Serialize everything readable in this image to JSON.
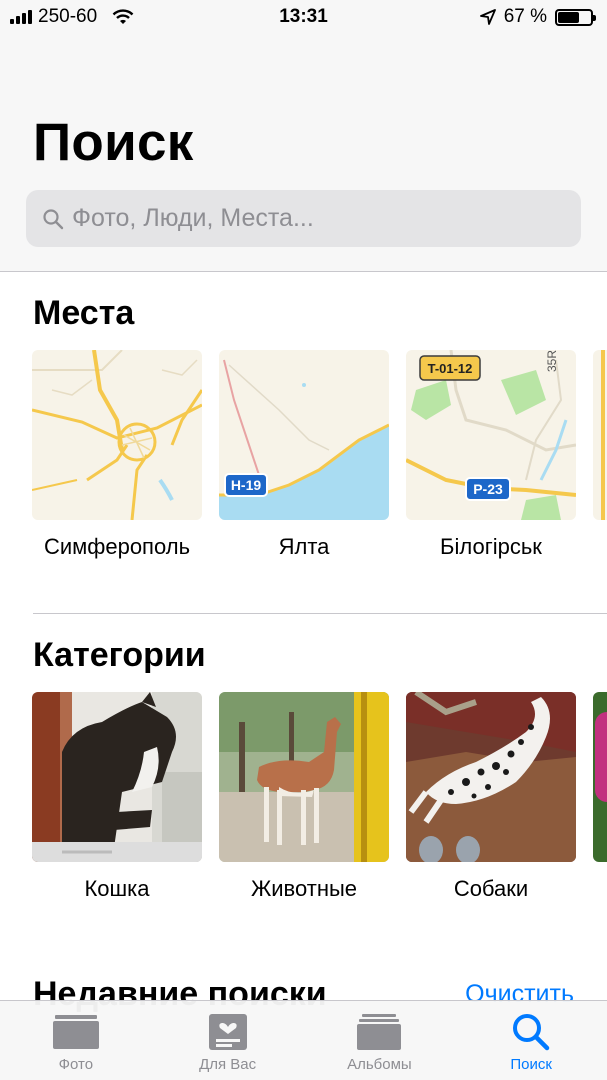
{
  "status_bar": {
    "carrier": "250-60",
    "time": "13:31",
    "battery_percent": "67 %",
    "battery_level": 0.67
  },
  "header": {
    "title": "Поиск"
  },
  "search": {
    "placeholder": "Фото, Люди, Места..."
  },
  "places": {
    "title": "Места",
    "items": [
      {
        "label": "Симферополь"
      },
      {
        "label": "Ялта",
        "road_badge": "H-19"
      },
      {
        "label": "Білогірськ",
        "road_badges": [
          "T-01-12",
          "P-23"
        ],
        "map_text": "35R"
      }
    ]
  },
  "categories": {
    "title": "Категории",
    "items": [
      {
        "label": "Кошка"
      },
      {
        "label": "Животные"
      },
      {
        "label": "Собаки"
      }
    ]
  },
  "recent": {
    "title": "Недавние поиски",
    "clear_label": "Очистить"
  },
  "tab_bar": {
    "tabs": [
      {
        "label": "Фото",
        "icon": "photos-icon",
        "active": false
      },
      {
        "label": "Для Вас",
        "icon": "for-you-icon",
        "active": false
      },
      {
        "label": "Альбомы",
        "icon": "albums-icon",
        "active": false
      },
      {
        "label": "Поиск",
        "icon": "search-icon",
        "active": true
      }
    ]
  },
  "colors": {
    "accent": "#007aff",
    "inactive": "#8e8e93",
    "map_land": "#f7f3e8",
    "map_road": "#f5c84c",
    "map_water": "#a9dcf2",
    "map_green": "#b9e5a5"
  }
}
